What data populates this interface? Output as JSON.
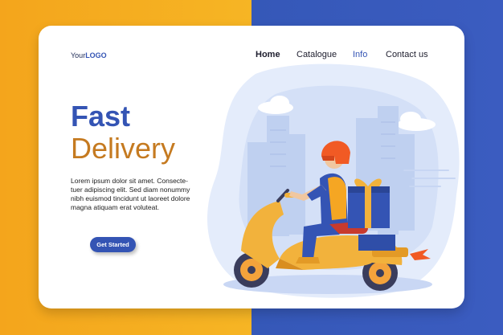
{
  "logo": {
    "prefix": "Your",
    "brand": "LOGO"
  },
  "nav": {
    "home": "Home",
    "catalogue": "Catalogue",
    "info": "Info",
    "contact": "Contact us"
  },
  "hero": {
    "title_line1": "Fast",
    "title_line2": "Delivery",
    "body": "Lorem ipsum dolor sit amet. Consecte-tuer adipiscing elit. Sed diam nonummy nibh euismod tincidunt ut laoreet dolore magna atiquam erat voluteat.",
    "cta_label": "Get Started"
  },
  "colors": {
    "left_bg": "#f5ad20",
    "right_bg": "#3858bc",
    "primary_blue": "#3454b4",
    "accent_orange": "#c57a20"
  },
  "illustration": {
    "subject": "delivery-courier-scooter",
    "icons": [
      "helmet",
      "gift-box",
      "scooter",
      "city-skyline",
      "cloud"
    ]
  }
}
